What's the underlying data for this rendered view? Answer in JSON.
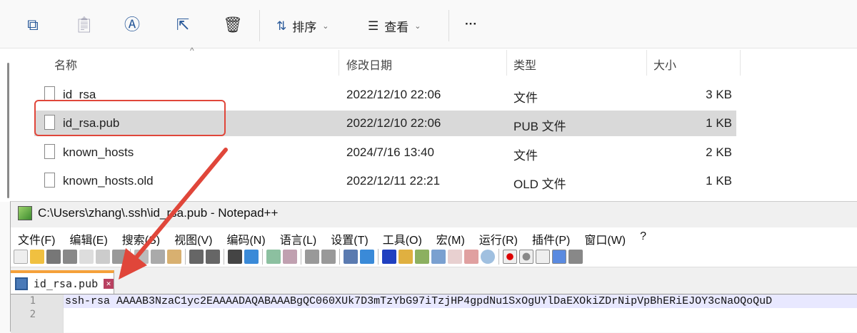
{
  "explorer": {
    "toolbar": {
      "copy": "copy-icon",
      "paste": "paste-icon",
      "rename": "rename-icon",
      "share": "share-icon",
      "delete": "delete-icon",
      "sort_label": "排序",
      "view_label": "查看",
      "more": "···"
    },
    "columns": [
      "名称",
      "修改日期",
      "类型",
      "大小"
    ],
    "files": [
      {
        "name": "id_rsa",
        "date": "2022/12/10 22:06",
        "type": "文件",
        "size": "3 KB"
      },
      {
        "name": "id_rsa.pub",
        "date": "2022/12/10 22:06",
        "type": "PUB 文件",
        "size": "1 KB",
        "selected": true
      },
      {
        "name": "known_hosts",
        "date": "2024/7/16 13:40",
        "type": "文件",
        "size": "2 KB"
      },
      {
        "name": "known_hosts.old",
        "date": "2022/12/11 22:21",
        "type": "OLD 文件",
        "size": "1 KB"
      }
    ]
  },
  "notepad": {
    "title": "C:\\Users\\zhang\\.ssh\\id_rsa.pub - Notepad++",
    "menu": [
      "文件(F)",
      "编辑(E)",
      "搜索(S)",
      "视图(V)",
      "编码(N)",
      "语言(L)",
      "设置(T)",
      "工具(O)",
      "宏(M)",
      "运行(R)",
      "插件(P)",
      "窗口(W)",
      "?"
    ],
    "tab": "id_rsa.pub",
    "close": "✕",
    "lines": [
      "1",
      "2"
    ],
    "content": "ssh-rsa AAAAB3NzaC1yc2EAAAADAQABAAABgQC060XUk7D3mTzYbG97iTzjHP4gpdNu1SxOgUYlDaEXOkiZDrNipVpBhERiEJOY3cNaOQoQuD"
  },
  "annotation_color": "#e0463a"
}
